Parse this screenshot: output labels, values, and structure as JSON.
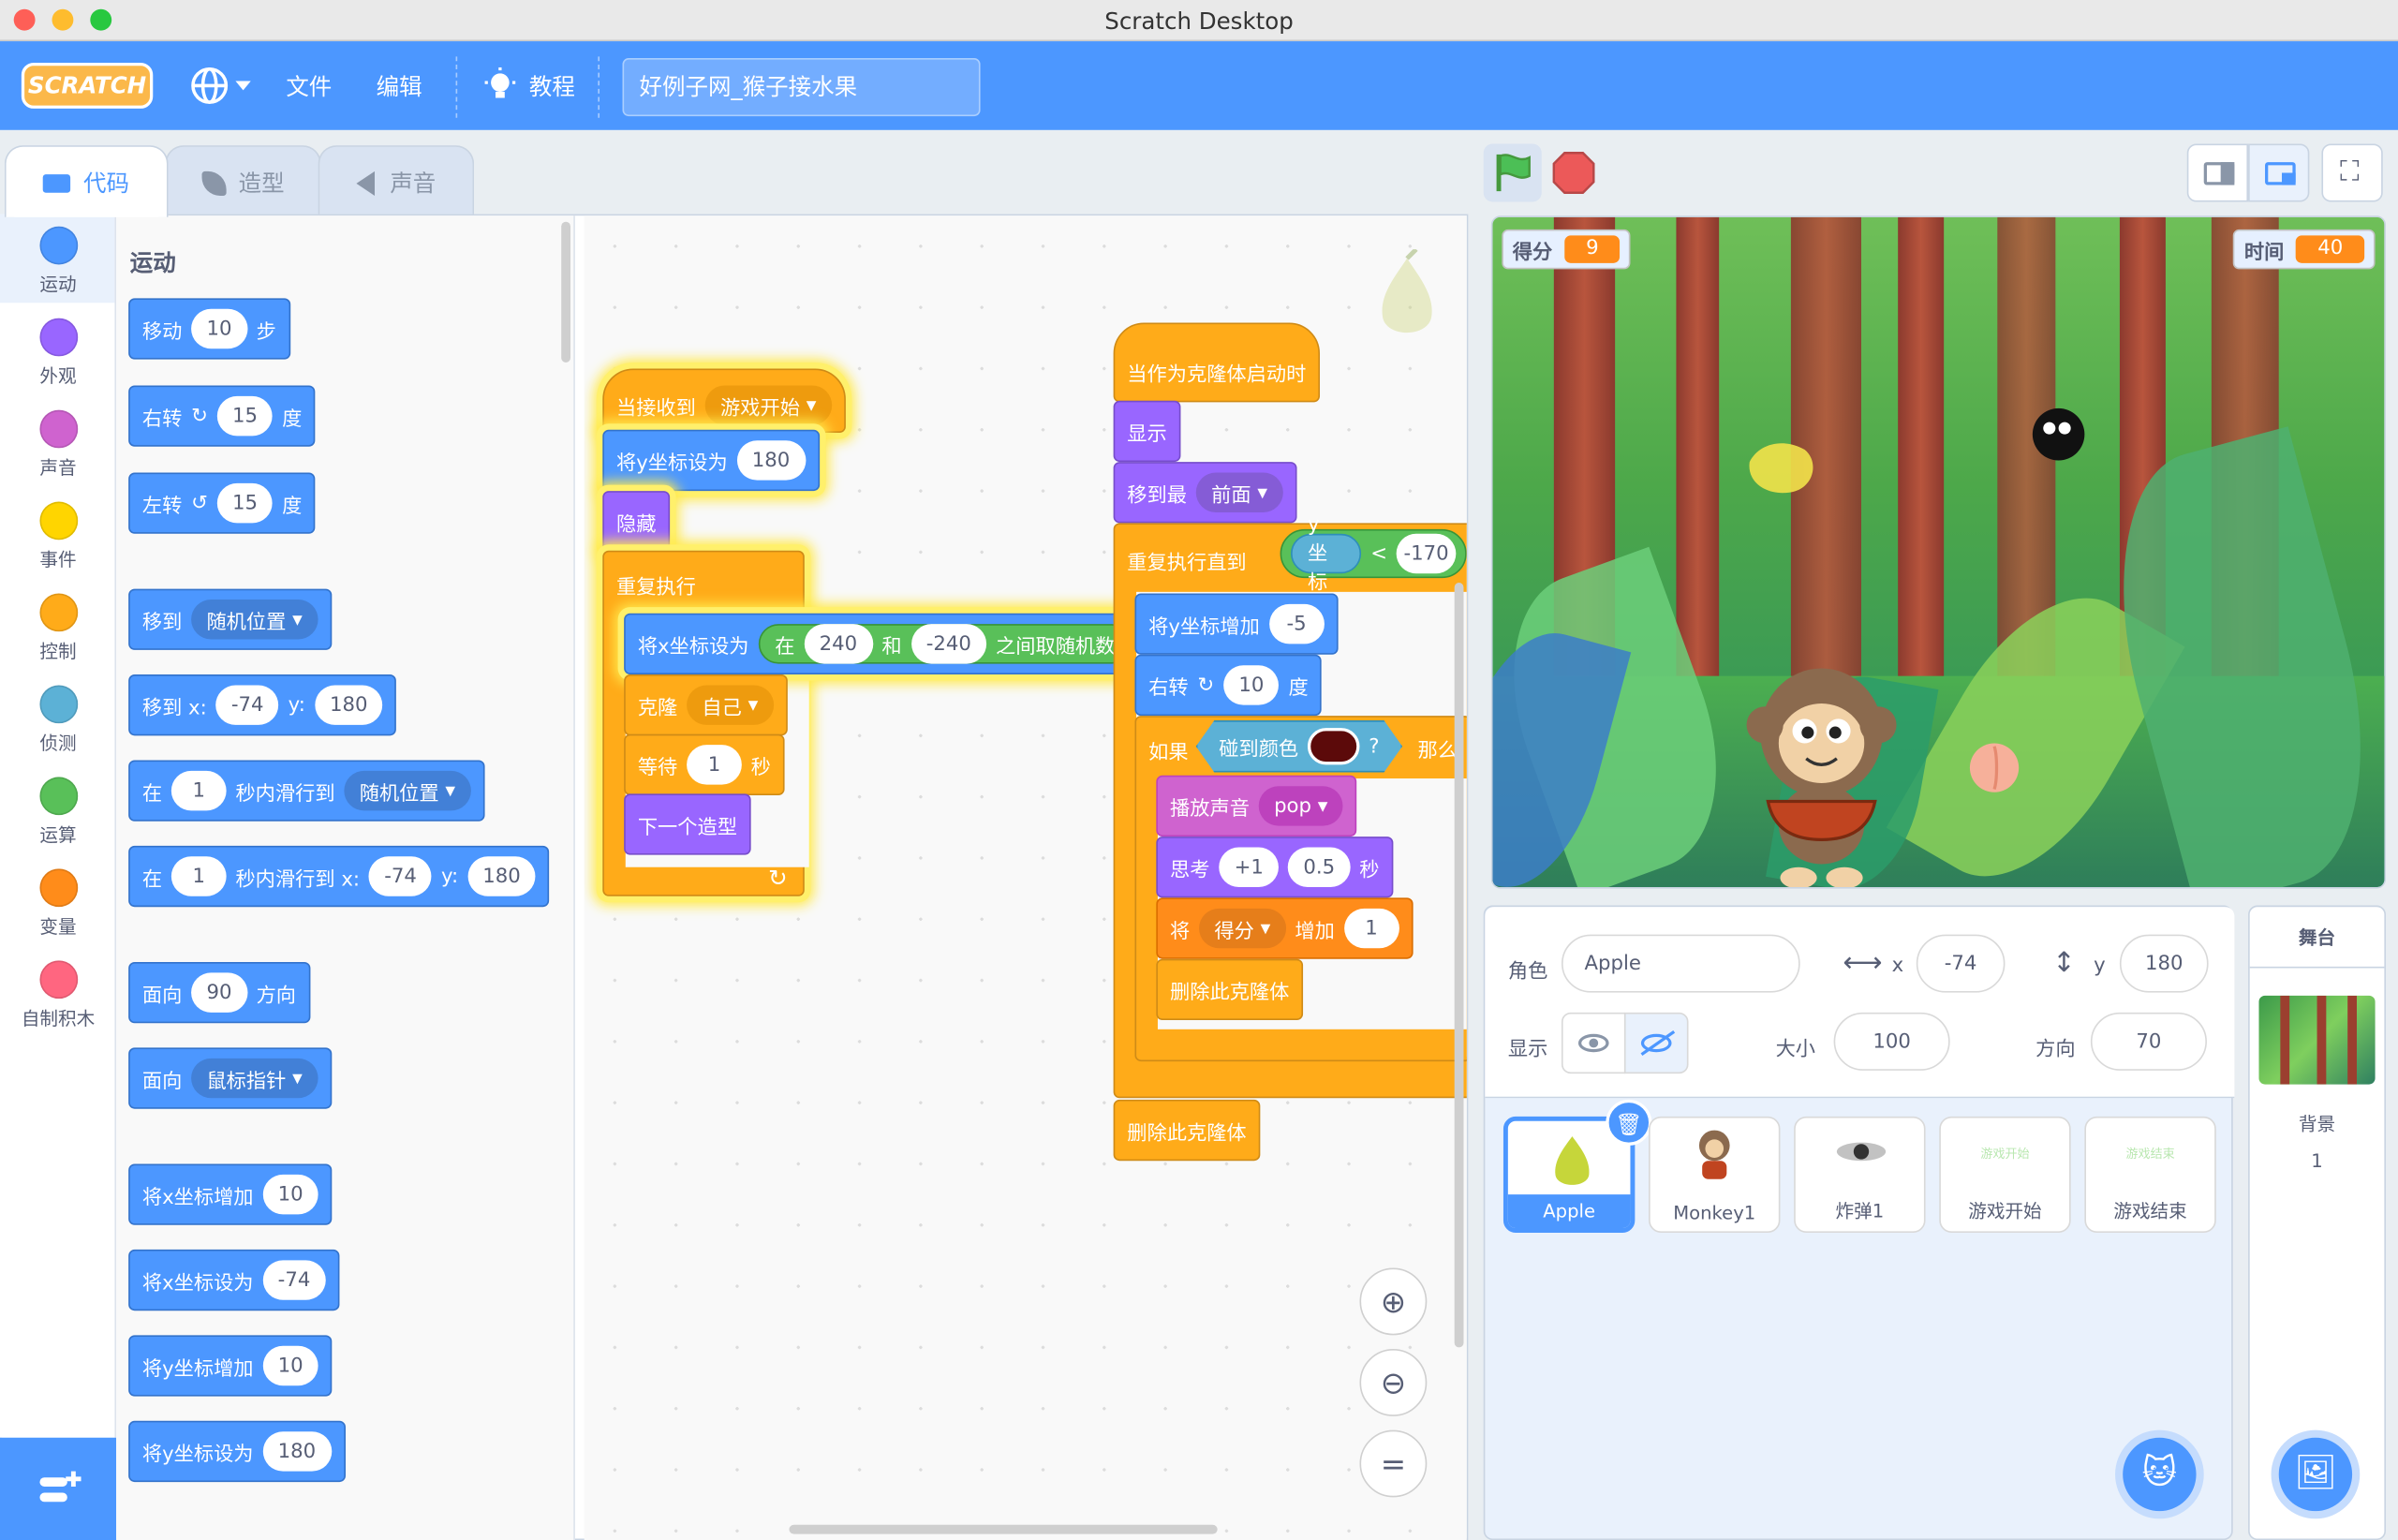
{
  "window": {
    "title": "Scratch Desktop"
  },
  "menu": {
    "logo": "SCRATCH",
    "file": "文件",
    "edit": "编辑",
    "tutorials": "教程",
    "project_title": "好例子网_猴子接水果"
  },
  "tabs": {
    "code": "代码",
    "costumes": "造型",
    "sounds": "声音"
  },
  "categories": [
    {
      "label": "运动",
      "color": "#4c97ff"
    },
    {
      "label": "外观",
      "color": "#9966ff"
    },
    {
      "label": "声音",
      "color": "#cf63cf"
    },
    {
      "label": "事件",
      "color": "#ffd500"
    },
    {
      "label": "控制",
      "color": "#ffab19"
    },
    {
      "label": "侦测",
      "color": "#5cb1d6"
    },
    {
      "label": "运算",
      "color": "#59c059"
    },
    {
      "label": "变量",
      "color": "#ff8c1a"
    },
    {
      "label": "自制积木",
      "color": "#ff6680"
    }
  ],
  "palette": {
    "heading": "运动",
    "move": "移动",
    "move_steps": "10",
    "steps": "步",
    "turn_right": "右转",
    "turn_right_deg": "15",
    "deg": "度",
    "turn_left": "左转",
    "turn_left_deg": "15",
    "goto": "移到",
    "goto_target": "随机位置",
    "goto_xy": "移到 x:",
    "x_val": "-74",
    "y_label": "y:",
    "y_val": "180",
    "glide_in": "在",
    "glide_secs": "1",
    "glide_to": "秒内滑行到",
    "glide_target": "随机位置",
    "glide_xy": "秒内滑行到 x:",
    "point": "面向",
    "point_deg": "90",
    "direction": "方向",
    "point_towards": "面向",
    "towards_target": "鼠标指针",
    "change_x": "将x坐标增加",
    "change_x_val": "10",
    "set_x": "将x坐标设为",
    "set_x_val": "-74",
    "change_y": "将y坐标增加",
    "change_y_val": "10",
    "set_y": "将y坐标设为",
    "set_y_val": "180"
  },
  "script1": {
    "when_receive": "当接收到",
    "message": "游戏开始",
    "set_y": "将y坐标设为",
    "set_y_val": "180",
    "hide": "隐藏",
    "forever": "重复执行",
    "set_x": "将x坐标设为",
    "pick": "在",
    "pick_a": "240",
    "pick_and": "和",
    "pick_b": "-240",
    "pick_tail": "之间取随机数",
    "clone": "克隆",
    "clone_target": "自己",
    "wait": "等待",
    "wait_val": "1",
    "wait_unit": "秒",
    "next_costume": "下一个造型"
  },
  "script2": {
    "when_clone": "当作为克隆体启动时",
    "show": "显示",
    "go_front": "移到最",
    "front": "前面",
    "repeat_until": "重复执行直到",
    "y_pos": "y 坐标",
    "lt": "<",
    "lt_val": "-170",
    "change_y": "将y坐标增加",
    "change_y_val": "-5",
    "turn": "右转",
    "turn_val": "10",
    "deg": "度",
    "if": "如果",
    "touch_color": "碰到颜色",
    "q": "?",
    "then": "那么",
    "play": "播放声音",
    "sound": "pop",
    "think": "思考",
    "think_val": "+1",
    "think_secs": "0.5",
    "secs": "秒",
    "change_var": "将",
    "var": "得分",
    "by": "增加",
    "by_val": "1",
    "delete": "删除此克隆体",
    "delete2": "删除此克隆体"
  },
  "stage": {
    "score_label": "得分",
    "score": "9",
    "time_label": "时间",
    "time": "40"
  },
  "sprite_info": {
    "sprite_label": "角色",
    "sprite_name": "Apple",
    "x_label": "x",
    "x": "-74",
    "y_label": "y",
    "y": "180",
    "show_label": "显示",
    "size_label": "大小",
    "size": "100",
    "dir_label": "方向",
    "dir": "70"
  },
  "sprites": [
    {
      "name": "Apple"
    },
    {
      "name": "Monkey1"
    },
    {
      "name": "炸弹1"
    },
    {
      "name": "游戏开始",
      "thumb": "游戏开始"
    },
    {
      "name": "游戏结束",
      "thumb": "游戏结束"
    }
  ],
  "stage_panel": {
    "title": "舞台",
    "backdrop_label": "背景",
    "backdrop_count": "1"
  }
}
